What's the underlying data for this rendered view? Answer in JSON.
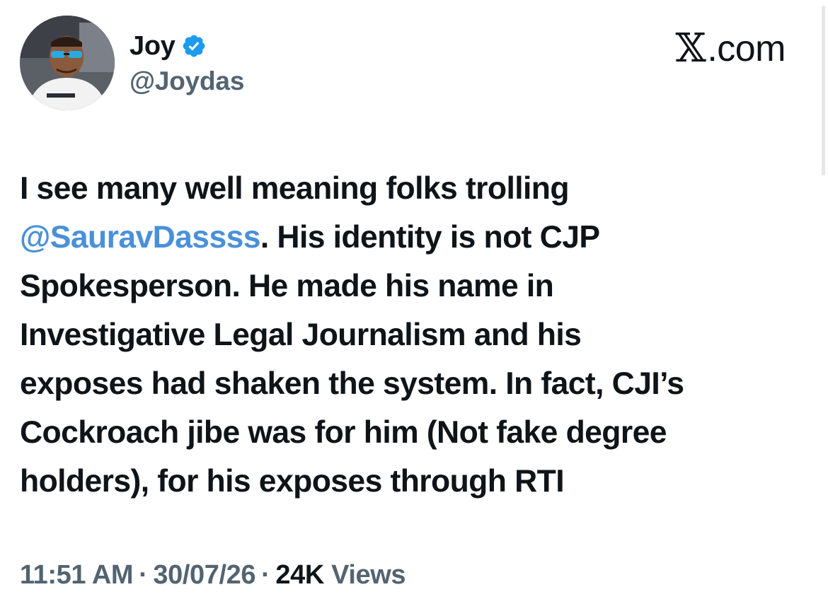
{
  "author": {
    "name": "Joy",
    "handle": "@Joydas",
    "verified": true,
    "avatar_icon": "profile-photo-icon",
    "verified_color": "#1d9bf0"
  },
  "brand": {
    "label": ".com",
    "glyph": "𝕏"
  },
  "post": {
    "lines": [
      {
        "text_before": "",
        "mention": "",
        "text_after": "I see many well meaning folks trolling"
      },
      {
        "text_before": "",
        "mention": "@SauravDassss",
        "text_after": ". His identity is not CJP"
      },
      {
        "text_before": "",
        "mention": "",
        "text_after": "Spokesperson. He made his name in"
      },
      {
        "text_before": "",
        "mention": "",
        "text_after": "Investigative Legal Journalism and his"
      },
      {
        "text_before": "",
        "mention": "",
        "text_after": "exposes had shaken the system. In fact, CJI’s"
      },
      {
        "text_before": "",
        "mention": "",
        "text_after": "Cockroach jibe was for him (Not fake degree"
      },
      {
        "text_before": "",
        "mention": "",
        "text_after": "holders), for his exposes through RTI"
      }
    ],
    "mention_color": "#4a90d9"
  },
  "meta": {
    "time": "11:51 AM",
    "separator": "·",
    "date": "30/07/26",
    "views_count": "24K",
    "views_label": "Views"
  }
}
